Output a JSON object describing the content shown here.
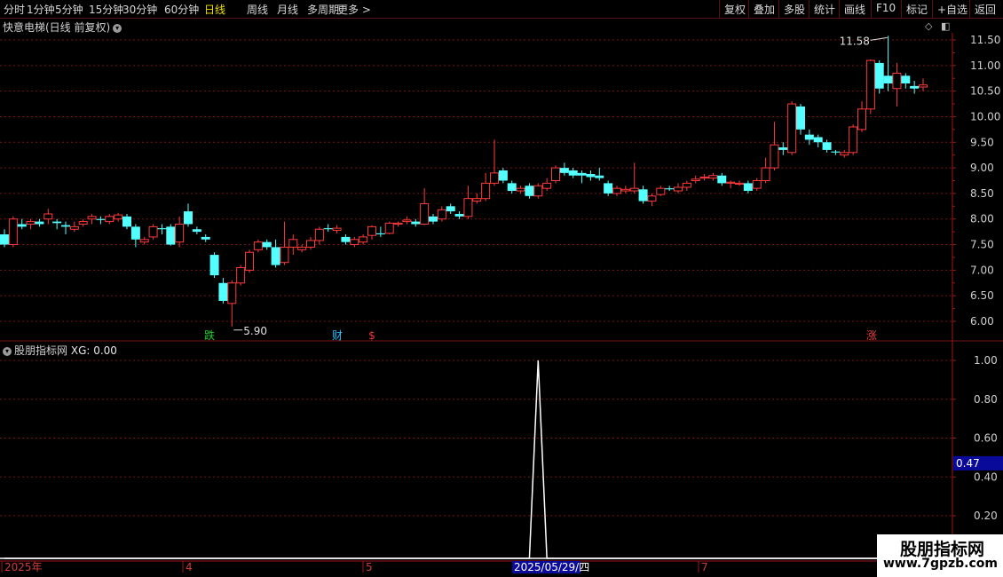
{
  "toolbar": {
    "left_items": [
      "分时",
      "1分钟",
      "5分钟",
      "15分钟",
      "30分钟",
      "60分钟",
      "日线",
      "周线",
      "月线",
      "多周期",
      "更多 >"
    ],
    "active_item": "日线",
    "right_items": [
      "复权",
      "叠加",
      "多股",
      "统计",
      "画线",
      "F10",
      "标记",
      "+自选",
      "返回"
    ]
  },
  "main_title": "快意电梯(日线 前复权)",
  "price_axis": [
    "11.50",
    "11.00",
    "10.50",
    "10.00",
    "9.50",
    "9.00",
    "8.50",
    "8.00",
    "7.50",
    "7.00",
    "6.50",
    "6.00"
  ],
  "annotations": {
    "high_label": "11.58",
    "low_label": "5.90",
    "markers": [
      {
        "text": "跌",
        "color": "#22d02a"
      },
      {
        "text": "财",
        "color": "#30c0ff"
      },
      {
        "text": "$",
        "color": "#e83a3a"
      },
      {
        "text": "涨",
        "color": "#e83a3a"
      }
    ]
  },
  "indicator": {
    "name": "股朋指标网",
    "label": "XG: 0.00",
    "axis": [
      "1.00",
      "0.80",
      "0.60",
      "0.40",
      "0.20"
    ],
    "current_value": "0.47"
  },
  "date_axis": {
    "labels": [
      "2025年",
      "4",
      "5",
      "7"
    ],
    "cursor_date": "2025/05/29/四"
  },
  "watermark": {
    "line1": "股朋指标网",
    "line2": "www.7gpzb.com"
  },
  "colors": {
    "up": "#ff3b3b",
    "down": "#54ffff",
    "grid": "#7a1515",
    "active_menu": "#f0e000"
  },
  "chart_data": {
    "type": "candlestick",
    "y_range": [
      5.75,
      11.8
    ],
    "candles": [
      [
        7.7,
        7.5,
        7.8,
        7.45
      ],
      [
        7.5,
        8.0,
        8.05,
        7.45
      ],
      [
        7.9,
        7.85,
        8.0,
        7.8
      ],
      [
        7.9,
        7.95,
        8.0,
        7.8
      ],
      [
        7.95,
        7.9,
        8.0,
        7.85
      ],
      [
        8.0,
        8.1,
        8.2,
        7.9
      ],
      [
        7.95,
        7.92,
        8.0,
        7.8
      ],
      [
        7.88,
        7.85,
        7.95,
        7.7
      ],
      [
        7.8,
        7.85,
        7.95,
        7.75
      ],
      [
        7.9,
        7.95,
        8.0,
        7.85
      ],
      [
        8.0,
        8.05,
        8.1,
        7.9
      ],
      [
        8.0,
        7.98,
        8.05,
        7.9
      ],
      [
        7.95,
        8.05,
        8.1,
        7.9
      ],
      [
        8.0,
        8.08,
        8.12,
        7.95
      ],
      [
        8.05,
        7.85,
        8.1,
        7.8
      ],
      [
        7.85,
        7.6,
        7.9,
        7.45
      ],
      [
        7.55,
        7.6,
        7.65,
        7.5
      ],
      [
        7.65,
        7.85,
        7.9,
        7.6
      ],
      [
        7.82,
        7.8,
        7.9,
        7.7
      ],
      [
        7.85,
        7.5,
        7.9,
        7.48
      ],
      [
        7.55,
        7.9,
        8.05,
        7.45
      ],
      [
        8.15,
        7.9,
        8.3,
        7.85
      ],
      [
        7.8,
        7.75,
        7.85,
        7.7
      ],
      [
        7.65,
        7.6,
        7.7,
        7.55
      ],
      [
        7.3,
        6.9,
        7.35,
        6.85
      ],
      [
        6.75,
        6.4,
        6.85,
        6.35
      ],
      [
        6.35,
        6.75,
        6.8,
        5.9
      ],
      [
        6.75,
        7.05,
        7.1,
        6.7
      ],
      [
        7.0,
        7.35,
        7.4,
        6.95
      ],
      [
        7.4,
        7.55,
        7.6,
        7.35
      ],
      [
        7.55,
        7.45,
        7.6,
        7.4
      ],
      [
        7.45,
        7.1,
        7.6,
        7.05
      ],
      [
        7.15,
        7.45,
        7.95,
        7.1
      ],
      [
        7.45,
        7.6,
        7.7,
        7.3
      ],
      [
        7.4,
        7.45,
        7.5,
        7.35
      ],
      [
        7.45,
        7.58,
        7.65,
        7.4
      ],
      [
        7.58,
        7.8,
        7.85,
        7.5
      ],
      [
        7.82,
        7.8,
        7.9,
        7.75
      ],
      [
        7.78,
        7.82,
        7.88,
        7.72
      ],
      [
        7.65,
        7.55,
        7.7,
        7.5
      ],
      [
        7.5,
        7.6,
        7.65,
        7.45
      ],
      [
        7.55,
        7.65,
        7.7,
        7.5
      ],
      [
        7.68,
        7.85,
        7.88,
        7.6
      ],
      [
        7.72,
        7.7,
        7.85,
        7.65
      ],
      [
        7.72,
        7.92,
        7.95,
        7.7
      ],
      [
        7.9,
        7.92,
        7.95,
        7.85
      ],
      [
        7.95,
        7.98,
        8.05,
        7.9
      ],
      [
        7.95,
        7.9,
        8.0,
        7.85
      ],
      [
        7.9,
        8.3,
        8.6,
        7.88
      ],
      [
        8.05,
        7.95,
        8.1,
        7.9
      ],
      [
        8.0,
        8.18,
        8.25,
        7.95
      ],
      [
        8.25,
        8.15,
        8.3,
        8.1
      ],
      [
        8.1,
        8.05,
        8.15,
        8.0
      ],
      [
        8.05,
        8.4,
        8.65,
        8.0
      ],
      [
        8.35,
        8.4,
        8.5,
        8.3
      ],
      [
        8.4,
        8.7,
        8.9,
        8.35
      ],
      [
        8.7,
        8.9,
        9.55,
        8.65
      ],
      [
        8.95,
        8.75,
        9.0,
        8.7
      ],
      [
        8.7,
        8.55,
        8.75,
        8.5
      ],
      [
        8.55,
        8.6,
        8.65,
        8.5
      ],
      [
        8.65,
        8.45,
        8.7,
        8.4
      ],
      [
        8.45,
        8.65,
        8.7,
        8.4
      ],
      [
        8.6,
        8.7,
        8.8,
        8.55
      ],
      [
        8.75,
        9.0,
        9.05,
        8.7
      ],
      [
        9.0,
        8.9,
        9.1,
        8.85
      ],
      [
        8.95,
        8.85,
        9.0,
        8.8
      ],
      [
        8.9,
        8.85,
        8.95,
        8.7
      ],
      [
        8.88,
        8.82,
        8.95,
        8.75
      ],
      [
        8.85,
        8.8,
        9.0,
        8.75
      ],
      [
        8.7,
        8.5,
        8.75,
        8.45
      ],
      [
        8.5,
        8.6,
        8.65,
        8.45
      ],
      [
        8.55,
        8.58,
        8.65,
        8.5
      ],
      [
        8.55,
        8.6,
        9.1,
        8.5
      ],
      [
        8.58,
        8.35,
        8.65,
        8.3
      ],
      [
        8.35,
        8.45,
        8.5,
        8.25
      ],
      [
        8.48,
        8.6,
        8.65,
        8.45
      ],
      [
        8.6,
        8.58,
        8.65,
        8.55
      ],
      [
        8.55,
        8.62,
        8.7,
        8.5
      ],
      [
        8.62,
        8.7,
        8.75,
        8.55
      ],
      [
        8.75,
        8.78,
        8.85,
        8.7
      ],
      [
        8.8,
        8.82,
        8.88,
        8.75
      ],
      [
        8.8,
        8.85,
        8.9,
        8.75
      ],
      [
        8.85,
        8.7,
        8.9,
        8.65
      ],
      [
        8.7,
        8.72,
        8.75,
        8.6
      ],
      [
        8.68,
        8.7,
        8.75,
        8.65
      ],
      [
        8.7,
        8.55,
        8.75,
        8.5
      ],
      [
        8.6,
        8.75,
        8.8,
        8.55
      ],
      [
        8.75,
        9.0,
        9.2,
        8.7
      ],
      [
        9.0,
        9.45,
        9.9,
        8.95
      ],
      [
        9.4,
        9.35,
        9.5,
        9.25
      ],
      [
        9.3,
        10.25,
        10.3,
        9.25
      ],
      [
        10.2,
        9.75,
        10.25,
        9.65
      ],
      [
        9.65,
        9.55,
        9.75,
        9.45
      ],
      [
        9.6,
        9.5,
        9.65,
        9.4
      ],
      [
        9.5,
        9.35,
        9.55,
        9.3
      ],
      [
        9.32,
        9.3,
        9.35,
        9.25
      ],
      [
        9.25,
        9.3,
        9.35,
        9.2
      ],
      [
        9.3,
        9.8,
        9.85,
        9.25
      ],
      [
        9.75,
        10.15,
        10.3,
        9.7
      ],
      [
        10.15,
        11.1,
        11.12,
        10.05
      ],
      [
        11.05,
        10.55,
        11.1,
        10.45
      ],
      [
        10.8,
        10.65,
        11.58,
        10.5
      ],
      [
        10.55,
        10.85,
        11.05,
        10.2
      ],
      [
        10.8,
        10.65,
        10.85,
        10.55
      ],
      [
        10.6,
        10.55,
        10.7,
        10.45
      ],
      [
        10.58,
        10.62,
        10.75,
        10.5
      ]
    ],
    "indicator_series": {
      "name": "XG",
      "signal_index": 61,
      "values": "0 everywhere except 1.00 at signal_index"
    },
    "indicator_y_range": [
      0,
      1.05
    ]
  }
}
